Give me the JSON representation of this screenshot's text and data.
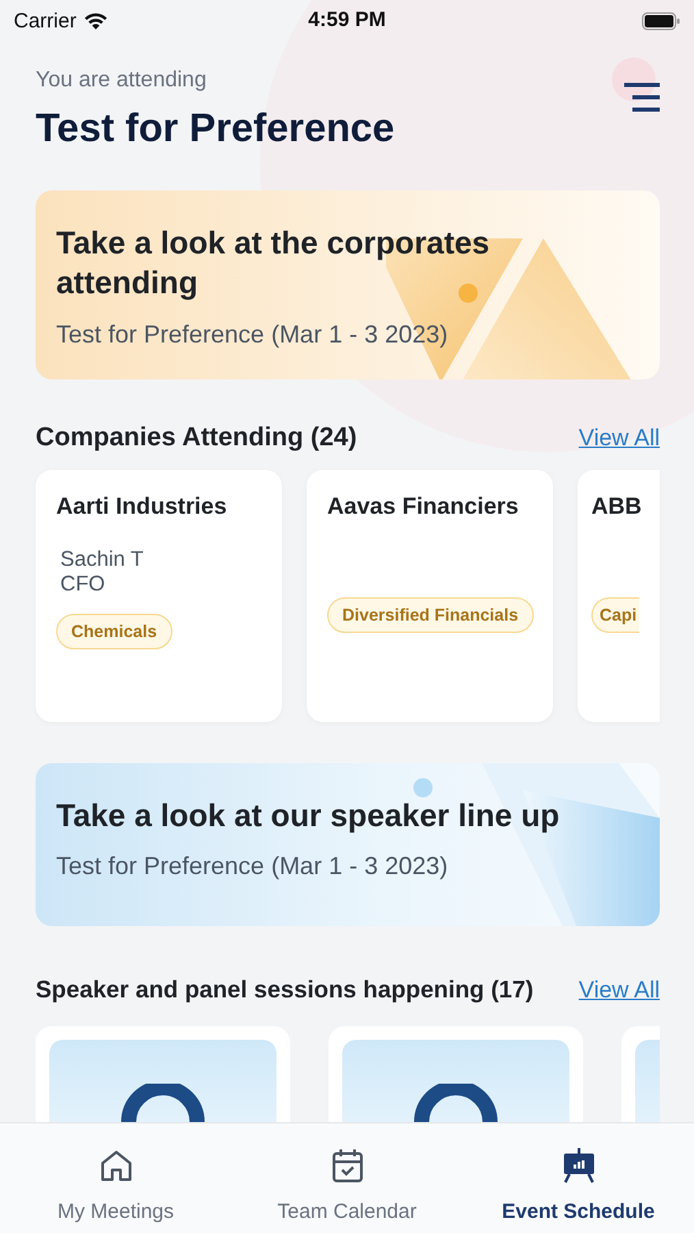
{
  "status_bar": {
    "carrier": "Carrier",
    "time": "4:59 PM"
  },
  "header": {
    "subtitle": "You are attending",
    "title": "Test for Preference"
  },
  "banners": [
    {
      "kind": "corporates",
      "title": "Take a look at the corporates attending",
      "subtitle": "Test for Preference (Mar 1 - 3 2023)"
    },
    {
      "kind": "speakers",
      "title": "Take a look at our speaker line up",
      "subtitle": "Test for Preference (Mar 1 - 3 2023)"
    }
  ],
  "companies": {
    "heading": "Companies Attending (24)",
    "link": "View All",
    "cards": [
      {
        "name": "Aarti Industries",
        "contact": "Sachin T",
        "role": "CFO",
        "tag": "Chemicals"
      },
      {
        "name": "Aavas Financiers",
        "tag": "Diversified Financials"
      },
      {
        "name": "ABB",
        "tag": "Capi"
      }
    ]
  },
  "sessions": {
    "heading": "Speaker and panel sessions happening (17)",
    "link": "View All",
    "cards": [
      {
        "kind": "session"
      },
      {
        "kind": "session"
      },
      {
        "kind": "session"
      }
    ]
  },
  "tabs": [
    {
      "kind": "home",
      "label": "My Meetings",
      "selected": false
    },
    {
      "kind": "calendar",
      "label": "Team Calendar",
      "selected": false
    },
    {
      "kind": "presentation",
      "label": "Event Schedule",
      "selected": true
    }
  ]
}
